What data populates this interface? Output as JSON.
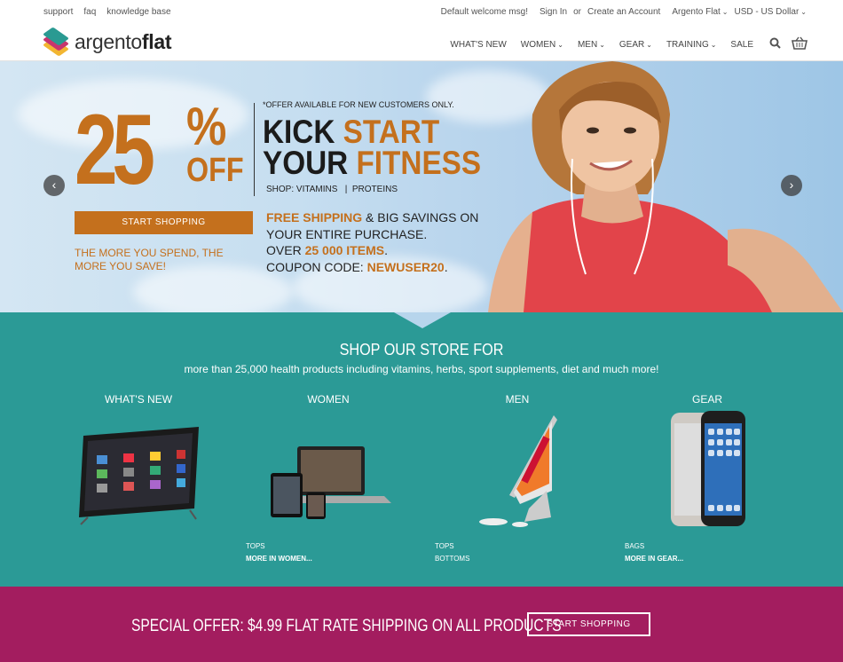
{
  "topbar": {
    "links": [
      "support",
      "faq",
      "knowledge base"
    ],
    "welcome": "Default welcome msg!",
    "sign_in": "Sign In",
    "or": "or",
    "create_account": "Create an Account",
    "store": "Argento Flat",
    "currency": "USD - US Dollar"
  },
  "header": {
    "logo_light": "argento",
    "logo_bold": "flat",
    "nav": [
      {
        "label": "WHAT'S NEW",
        "dropdown": false
      },
      {
        "label": "WOMEN",
        "dropdown": true
      },
      {
        "label": "MEN",
        "dropdown": true
      },
      {
        "label": "GEAR",
        "dropdown": true
      },
      {
        "label": "TRAINING",
        "dropdown": true
      },
      {
        "label": "SALE",
        "dropdown": false
      }
    ],
    "icons": [
      "search-icon",
      "cart-icon"
    ]
  },
  "hero": {
    "percent_number": "25",
    "percent_symbol": "%",
    "off": "OFF",
    "offer_note": "*OFFER AVAILABLE FOR NEW CUSTOMERS ONLY.",
    "kick_1": "KICK ",
    "kick_2": "START",
    "your_1": "YOUR ",
    "your_2": "FITNESS",
    "shop_line": "SHOP: VITAMINS   |  PROTEINS",
    "cta": "START SHOPPING",
    "more_spend": "THE MORE YOU SPEND, THE MORE YOU SAVE!",
    "perk_free": "FREE SHIPPING",
    "perk_free_rest": " & BIG SAVINGS ON",
    "perk_line2": "YOUR ENTIRE PURCHASE.",
    "perk_over": "OVER ",
    "perk_items": "25 000 ITEMS",
    "perk_dot": ".",
    "perk_coupon": "COUPON CODE: ",
    "perk_code": "NEWUSER20",
    "perk_dot2": ".",
    "colors": {
      "accent": "#c4701d",
      "sky": "#b6d3ec"
    }
  },
  "store": {
    "title": "SHOP OUR STORE FOR",
    "subtitle": "more than 25,000 health products including vitamins, herbs, sport supplements, diet and much more!",
    "categories": [
      {
        "title": "WHAT'S NEW",
        "links": [],
        "more": ""
      },
      {
        "title": "WOMEN",
        "links": [
          "TOPS"
        ],
        "more": "MORE IN WOMEN..."
      },
      {
        "title": "MEN",
        "links": [
          "TOPS",
          "BOTTOMS"
        ],
        "more": ""
      },
      {
        "title": "GEAR",
        "links": [
          "BAGS"
        ],
        "more": "MORE IN GEAR..."
      }
    ],
    "color": "#2b9a96"
  },
  "promo": {
    "text": "SPECIAL OFFER: $4.99 FLAT RATE SHIPPING ON ALL PRODUCTS",
    "button": "START SHOPPING",
    "color": "#a31d5f"
  }
}
